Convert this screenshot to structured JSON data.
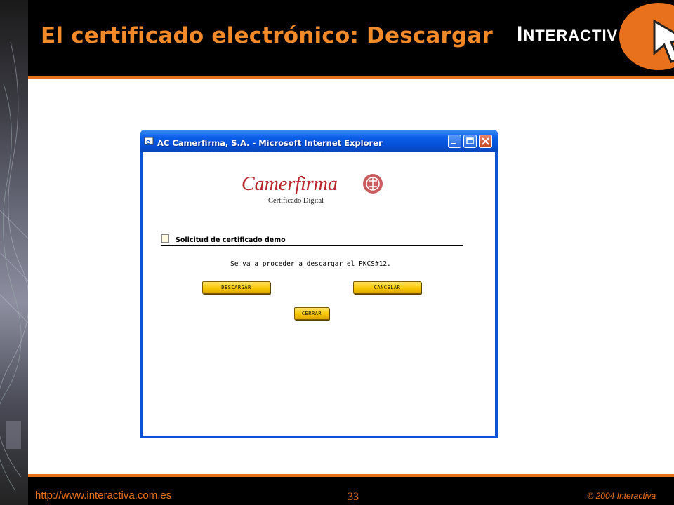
{
  "slide": {
    "title": "El certificado electrónico: Descargar",
    "logo_text_first": "I",
    "logo_text_rest": "NTERACTIV",
    "accent_color": "#e8711d"
  },
  "footer": {
    "url": "http://www.interactiva.com.es",
    "page_number": "33",
    "copyright": "© 2004 Interactiva"
  },
  "browser": {
    "title": "AC Camerfirma, S.A. - Microsoft Internet Explorer",
    "titlebar_color": "#0a53d6"
  },
  "page": {
    "brand_name": "Camerfirma",
    "brand_sub": "Certificado Digital",
    "brand_color": "#b8262b",
    "section_title": "Solicitud de certificado demo",
    "message": "Se va a proceder a descargar el PKCS#12.",
    "buttons": {
      "download": "DESCARGAR",
      "cancel": "CANCELAR",
      "close": "CERRAR"
    }
  }
}
